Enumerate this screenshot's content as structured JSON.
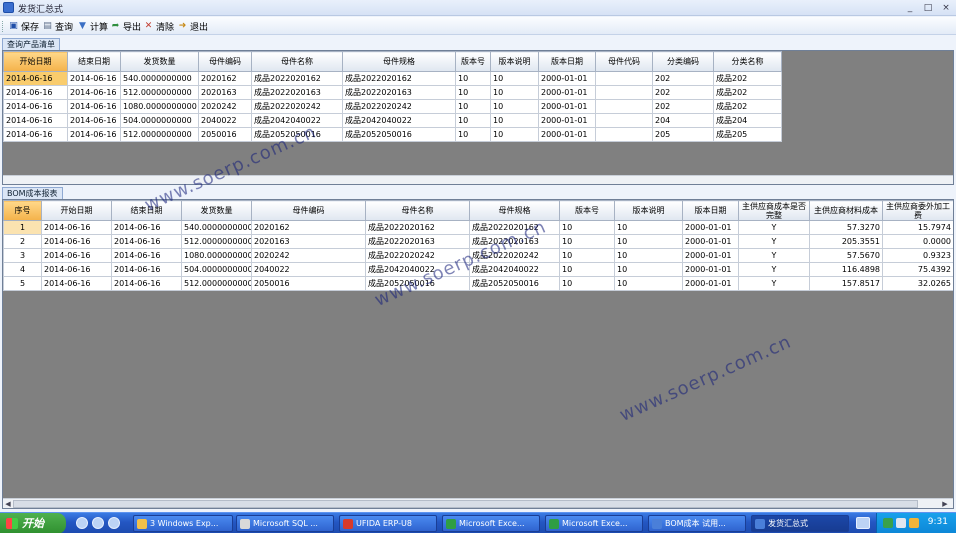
{
  "window": {
    "title": "发货汇总式",
    "min": "_",
    "max": "□",
    "close": "×"
  },
  "toolbar": [
    {
      "label": "保存",
      "icon": "save-icon",
      "glyph": "▣"
    },
    {
      "label": "查询",
      "icon": "document-search-icon",
      "glyph": "▤"
    },
    {
      "label": "计算",
      "icon": "funnel-icon",
      "glyph": "▼"
    },
    {
      "label": "导出",
      "icon": "export-icon",
      "glyph": "➦"
    },
    {
      "label": "清除",
      "icon": "clear-icon",
      "glyph": "✕"
    },
    {
      "label": "退出",
      "icon": "exit-icon",
      "glyph": "➜"
    }
  ],
  "top_section": {
    "label": "查询产品清单",
    "columns": [
      "开始日期",
      "结束日期",
      "发货数量",
      "母件编码",
      "母件名称",
      "母件规格",
      "版本号",
      "版本说明",
      "版本日期",
      "母件代码",
      "分类编码",
      "分类名称"
    ],
    "rows": [
      [
        "2014-06-16",
        "2014-06-16",
        "540.0000000000",
        "2020162",
        "成品2022020162",
        "成品2022020162",
        "10",
        "10",
        "2000-01-01",
        "",
        "202",
        "成品202"
      ],
      [
        "2014-06-16",
        "2014-06-16",
        "512.0000000000",
        "2020163",
        "成品2022020163",
        "成品2022020163",
        "10",
        "10",
        "2000-01-01",
        "",
        "202",
        "成品202"
      ],
      [
        "2014-06-16",
        "2014-06-16",
        "1080.0000000000",
        "2020242",
        "成品2022020242",
        "成品2022020242",
        "10",
        "10",
        "2000-01-01",
        "",
        "202",
        "成品202"
      ],
      [
        "2014-06-16",
        "2014-06-16",
        "504.0000000000",
        "2040022",
        "成品2042040022",
        "成品2042040022",
        "10",
        "10",
        "2000-01-01",
        "",
        "204",
        "成品204"
      ],
      [
        "2014-06-16",
        "2014-06-16",
        "512.0000000000",
        "2050016",
        "成品2052050016",
        "成品2052050016",
        "10",
        "10",
        "2000-01-01",
        "",
        "205",
        "成品205"
      ]
    ]
  },
  "bottom_section": {
    "label": "BOM成本报表",
    "columns": [
      "序号",
      "开始日期",
      "结束日期",
      "发货数量",
      "母件编码",
      "母件名称",
      "母件规格",
      "版本号",
      "版本说明",
      "版本日期",
      "主供应商成本是否完整",
      "主供应商材料成本",
      "主供应商委外加工费"
    ],
    "rows": [
      [
        "1",
        "2014-06-16",
        "2014-06-16",
        "540.0000000000",
        "2020162",
        "成品2022020162",
        "成品2022020162",
        "10",
        "10",
        "2000-01-01",
        "Y",
        "57.3270",
        "15.7974"
      ],
      [
        "2",
        "2014-06-16",
        "2014-06-16",
        "512.0000000000",
        "2020163",
        "成品2022020163",
        "成品2022020163",
        "10",
        "10",
        "2000-01-01",
        "Y",
        "205.3551",
        "0.0000"
      ],
      [
        "3",
        "2014-06-16",
        "2014-06-16",
        "1080.0000000000",
        "2020242",
        "成品2022020242",
        "成品2022020242",
        "10",
        "10",
        "2000-01-01",
        "Y",
        "57.5670",
        "0.9323"
      ],
      [
        "4",
        "2014-06-16",
        "2014-06-16",
        "504.0000000000",
        "2040022",
        "成品2042040022",
        "成品2042040022",
        "10",
        "10",
        "2000-01-01",
        "Y",
        "116.4898",
        "75.4392"
      ],
      [
        "5",
        "2014-06-16",
        "2014-06-16",
        "512.0000000000",
        "2050016",
        "成品2052050016",
        "成品2052050016",
        "10",
        "10",
        "2000-01-01",
        "Y",
        "157.8517",
        "32.0265"
      ]
    ]
  },
  "watermark": "www.soerp.com.cn",
  "taskbar": {
    "start": "开始",
    "tasks": [
      {
        "label": "3 Windows Exp...",
        "color": "#f2c04a"
      },
      {
        "label": "Microsoft SQL ...",
        "color": "#d9d9d9"
      },
      {
        "label": "UFIDA ERP-U8",
        "color": "#d93a2b"
      },
      {
        "label": "Microsoft Exce...",
        "color": "#2f9e44"
      },
      {
        "label": "Microsoft Exce...",
        "color": "#2f9e44"
      },
      {
        "label": "BOM成本  试用...",
        "color": "#4a7fd9"
      },
      {
        "label": "发货汇总式",
        "color": "#4a7fd9"
      }
    ],
    "clock": "9:31"
  }
}
